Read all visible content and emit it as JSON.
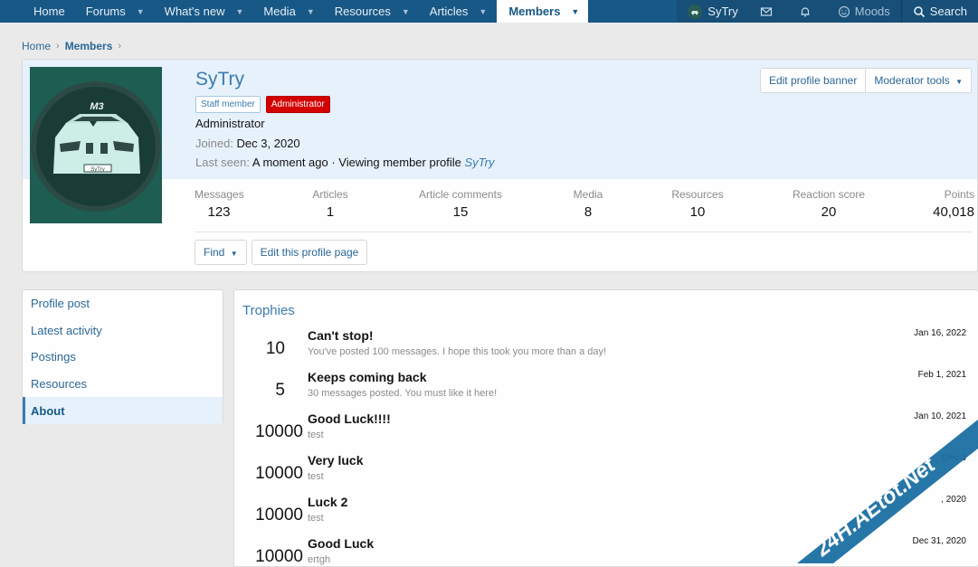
{
  "nav": {
    "items": [
      {
        "label": "Home",
        "caret": false
      },
      {
        "label": "Forums",
        "caret": true
      },
      {
        "label": "What's new",
        "caret": true
      },
      {
        "label": "Media",
        "caret": true
      },
      {
        "label": "Resources",
        "caret": true
      },
      {
        "label": "Articles",
        "caret": true
      },
      {
        "label": "Members",
        "caret": true,
        "active": true
      }
    ],
    "user": "SyTry",
    "moods": "Moods",
    "search": "Search"
  },
  "breadcrumb": {
    "home": "Home",
    "current": "Members"
  },
  "profile": {
    "name": "SyTry",
    "badge_staff": "Staff member",
    "badge_admin": "Administrator",
    "title": "Administrator",
    "joined_label": "Joined:",
    "joined_value": "Dec 3, 2020",
    "seen_label": "Last seen:",
    "seen_value": "A moment ago · Viewing member profile",
    "seen_link": "SyTry",
    "avatar_plate": "M3",
    "avatar_license": "SyTry",
    "edit_banner": "Edit profile banner",
    "moderator_tools": "Moderator tools",
    "find": "Find",
    "edit_profile": "Edit this profile page"
  },
  "stats": [
    {
      "label": "Messages",
      "value": "123"
    },
    {
      "label": "Articles",
      "value": "1"
    },
    {
      "label": "Article comments",
      "value": "15"
    },
    {
      "label": "Media",
      "value": "8"
    },
    {
      "label": "Resources",
      "value": "10"
    },
    {
      "label": "Reaction score",
      "value": "20"
    },
    {
      "label": "Points",
      "value": "40,018"
    }
  ],
  "tabs": [
    {
      "label": "Profile post"
    },
    {
      "label": "Latest activity"
    },
    {
      "label": "Postings"
    },
    {
      "label": "Resources"
    },
    {
      "label": "About",
      "active": true
    }
  ],
  "trophies": {
    "title": "Trophies",
    "items": [
      {
        "points": "10",
        "name": "Can't stop!",
        "desc": "You've posted 100 messages. I hope this took you more than a day!",
        "date": "Jan 16, 2022"
      },
      {
        "points": "5",
        "name": "Keeps coming back",
        "desc": "30 messages posted. You must like it here!",
        "date": "Feb 1, 2021"
      },
      {
        "points": "10000",
        "name": "Good Luck!!!!",
        "desc": "test",
        "date": "Jan 10, 2021"
      },
      {
        "points": "10000",
        "name": "Very luck",
        "desc": "test",
        "date": "Dec 3"
      },
      {
        "points": "10000",
        "name": "Luck 2",
        "desc": "test",
        "date": ", 2020"
      },
      {
        "points": "10000",
        "name": "Good Luck",
        "desc": "ertgh",
        "date": "Dec 31, 2020"
      }
    ]
  },
  "watermark": "24H.AEtot.Net",
  "colors": {
    "nav_bg": "#185886",
    "link": "#3a7cb0",
    "admin_badge": "#d40000",
    "banner_bg": "#e6f1fb"
  }
}
